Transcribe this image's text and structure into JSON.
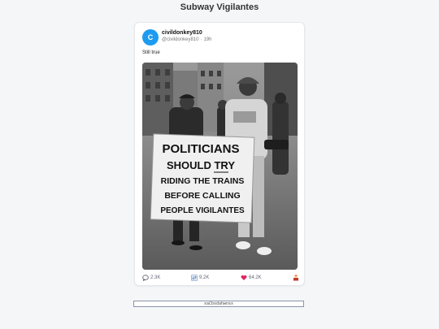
{
  "page": {
    "title": "Subway Vigilantes"
  },
  "post": {
    "avatar_letter": "C",
    "username": "civildonkey810",
    "handle": "@civildonkey810",
    "time": "19h",
    "text": "Still true",
    "image": {
      "sign_lines": [
        "POLITICIANS",
        "SHOULD TRY",
        "RIDING THE TRAINS",
        "BEFORE CALLING",
        "PEOPLE VIGILANTES"
      ]
    },
    "stats": {
      "replies": "2.3K",
      "retweets": "9.2K",
      "likes": "64.2K"
    },
    "icons": {
      "reply": "comment-icon",
      "retweet": "retweet-icon",
      "like": "heart-icon",
      "share": "share-icon"
    },
    "colors": {
      "avatar": "#1d9bf0",
      "like": "#e0245e",
      "share": "#e0245e"
    }
  },
  "footer": {
    "code": "xaCbsdahwnsx"
  }
}
